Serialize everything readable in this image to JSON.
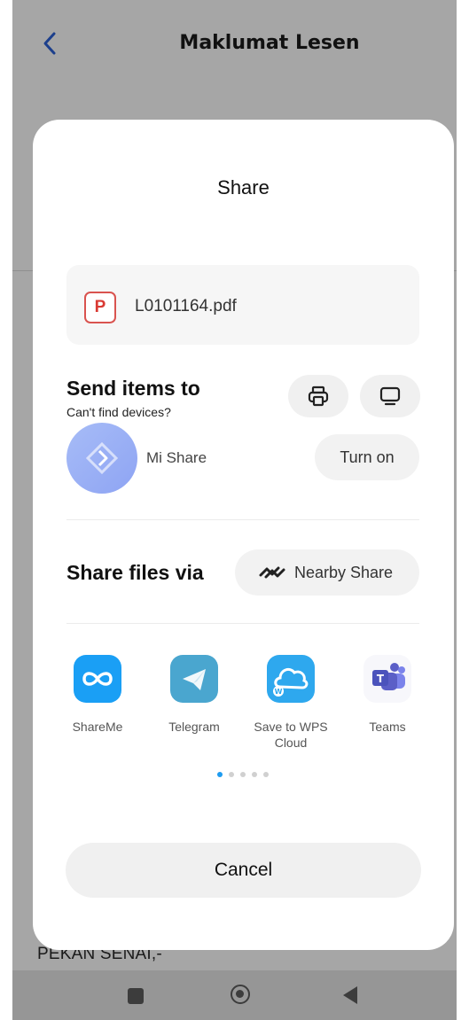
{
  "background_app": {
    "title": "Maklumat Lesen",
    "partial_text": "PEKAN SENAI,-"
  },
  "share_sheet": {
    "title": "Share",
    "file": {
      "type_letter": "P",
      "name": "L0101164.pdf"
    },
    "send_items": {
      "heading": "Send items to",
      "hint": "Can't find devices?",
      "printer_icon": "printer-icon",
      "screen_icon": "screen-cast-icon",
      "mi_share_label": "Mi Share",
      "turn_on_label": "Turn on"
    },
    "share_via": {
      "heading": "Share files via",
      "nearby_label": "Nearby Share"
    },
    "apps": [
      {
        "label": "ShareMe",
        "icon": "shareme-icon",
        "color": "#1a9ff5"
      },
      {
        "label": "Telegram",
        "icon": "telegram-icon",
        "color": "#4aa6cf"
      },
      {
        "label": "Save to WPS Cloud",
        "icon": "wps-cloud-icon",
        "color": "#2ea8ee"
      },
      {
        "label": "Teams",
        "icon": "teams-icon",
        "color": "#5b5fc7"
      }
    ],
    "page_indicator": {
      "total": 5,
      "active": 1
    },
    "cancel_label": "Cancel"
  },
  "colors": {
    "scrim": "#a6a6a6",
    "accent_dot": "#1e9cf0",
    "pdf_red": "#d93a33"
  }
}
